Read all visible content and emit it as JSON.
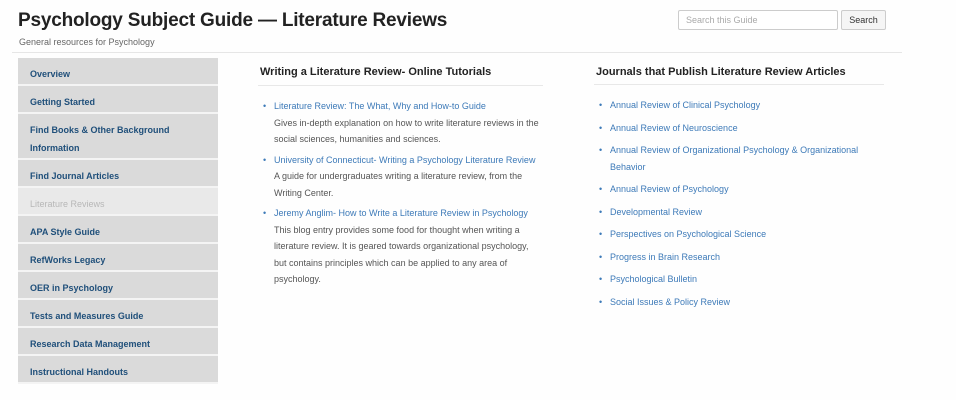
{
  "header": {
    "title": "Psychology Subject Guide — Literature Reviews",
    "subtitle": "General resources for Psychology",
    "search_placeholder": "Search this Guide",
    "search_button": "Search"
  },
  "sidebar": {
    "items": [
      {
        "label": "Overview",
        "active": false
      },
      {
        "label": "Getting Started",
        "active": false
      },
      {
        "label": "Find Books & Other Background Information",
        "active": false
      },
      {
        "label": "Find Journal Articles",
        "active": false
      },
      {
        "label": "Literature Reviews",
        "active": true
      },
      {
        "label": "APA Style Guide",
        "active": false
      },
      {
        "label": "RefWorks Legacy",
        "active": false
      },
      {
        "label": "OER in Psychology",
        "active": false
      },
      {
        "label": "Tests and Measures Guide",
        "active": false
      },
      {
        "label": "Research Data Management",
        "active": false
      },
      {
        "label": "Instructional Handouts",
        "active": false
      }
    ]
  },
  "tutorials": {
    "heading": "Writing a Literature Review- Online Tutorials",
    "items": [
      {
        "link": "Literature Review: The What, Why and How-to Guide",
        "description": "Gives in-depth explanation on how to write literature reviews in the social sciences, humanities and sciences."
      },
      {
        "link": "University of Connecticut- Writing a Psychology Literature Review",
        "description": "A guide for undergraduates writing a literature review, from the Writing Center."
      },
      {
        "link": "Jeremy Anglim- How to Write a Literature Review in Psychology",
        "description": "This blog entry provides some food for thought when writing a literature review. It is geared towards organizational psychology, but contains principles which can be applied to any area of psychology."
      }
    ]
  },
  "journals": {
    "heading": "Journals that Publish Literature Review Articles",
    "items": [
      "Annual Review of Clinical Psychology",
      "Annual Review of Neuroscience",
      "Annual Review of Organizational Psychology & Organizational Behavior",
      "Annual Review of Psychology",
      "Developmental Review",
      "Perspectives on Psychological Science",
      "Progress in Brain Research",
      "Psychological Bulletin",
      "Social Issues & Policy Review"
    ]
  }
}
